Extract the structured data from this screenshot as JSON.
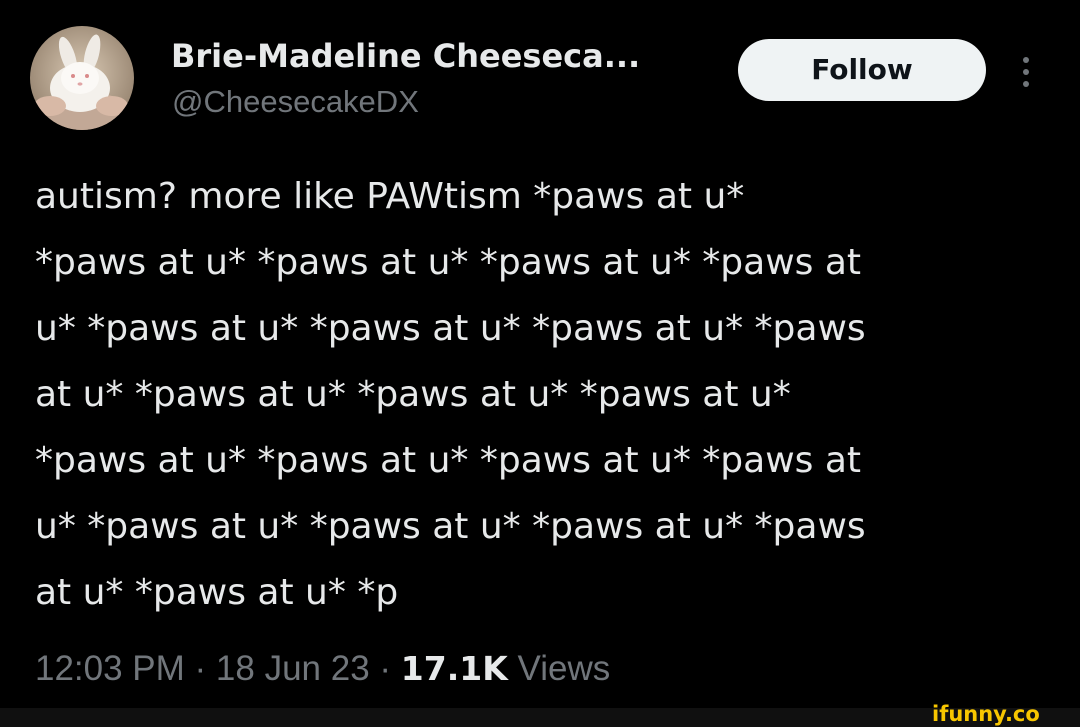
{
  "tweet": {
    "author": {
      "display_name": "Brie-Madeline Cheeseca...",
      "handle": "@CheesecakeDX",
      "avatar": "white-bunny-photo"
    },
    "follow_label": "Follow",
    "more_icon": "more-vertical-icon",
    "text_lines": [
      "autism? more like PAWtism *paws at u*",
      "*paws at u* *paws at u* *paws at u* *paws at",
      "u* *paws at u* *paws at u* *paws at u* *paws",
      "at u* *paws at u* *paws at u* *paws at u*",
      "*paws at u* *paws at u* *paws at u* *paws at",
      "u* *paws at u* *paws at u* *paws at u* *paws",
      "at u* *paws at u* *p"
    ],
    "time": "12:03 PM",
    "separator": " · ",
    "date": "18 Jun 23",
    "views_count": "17.1K",
    "views_label": " Views"
  },
  "watermark": {
    "text": "ifunny.co",
    "color": "#f7c600"
  },
  "colors": {
    "background": "#000000",
    "primary_text": "#e7e9ea",
    "secondary_text": "#71767b",
    "follow_button_bg": "#eff3f4"
  }
}
